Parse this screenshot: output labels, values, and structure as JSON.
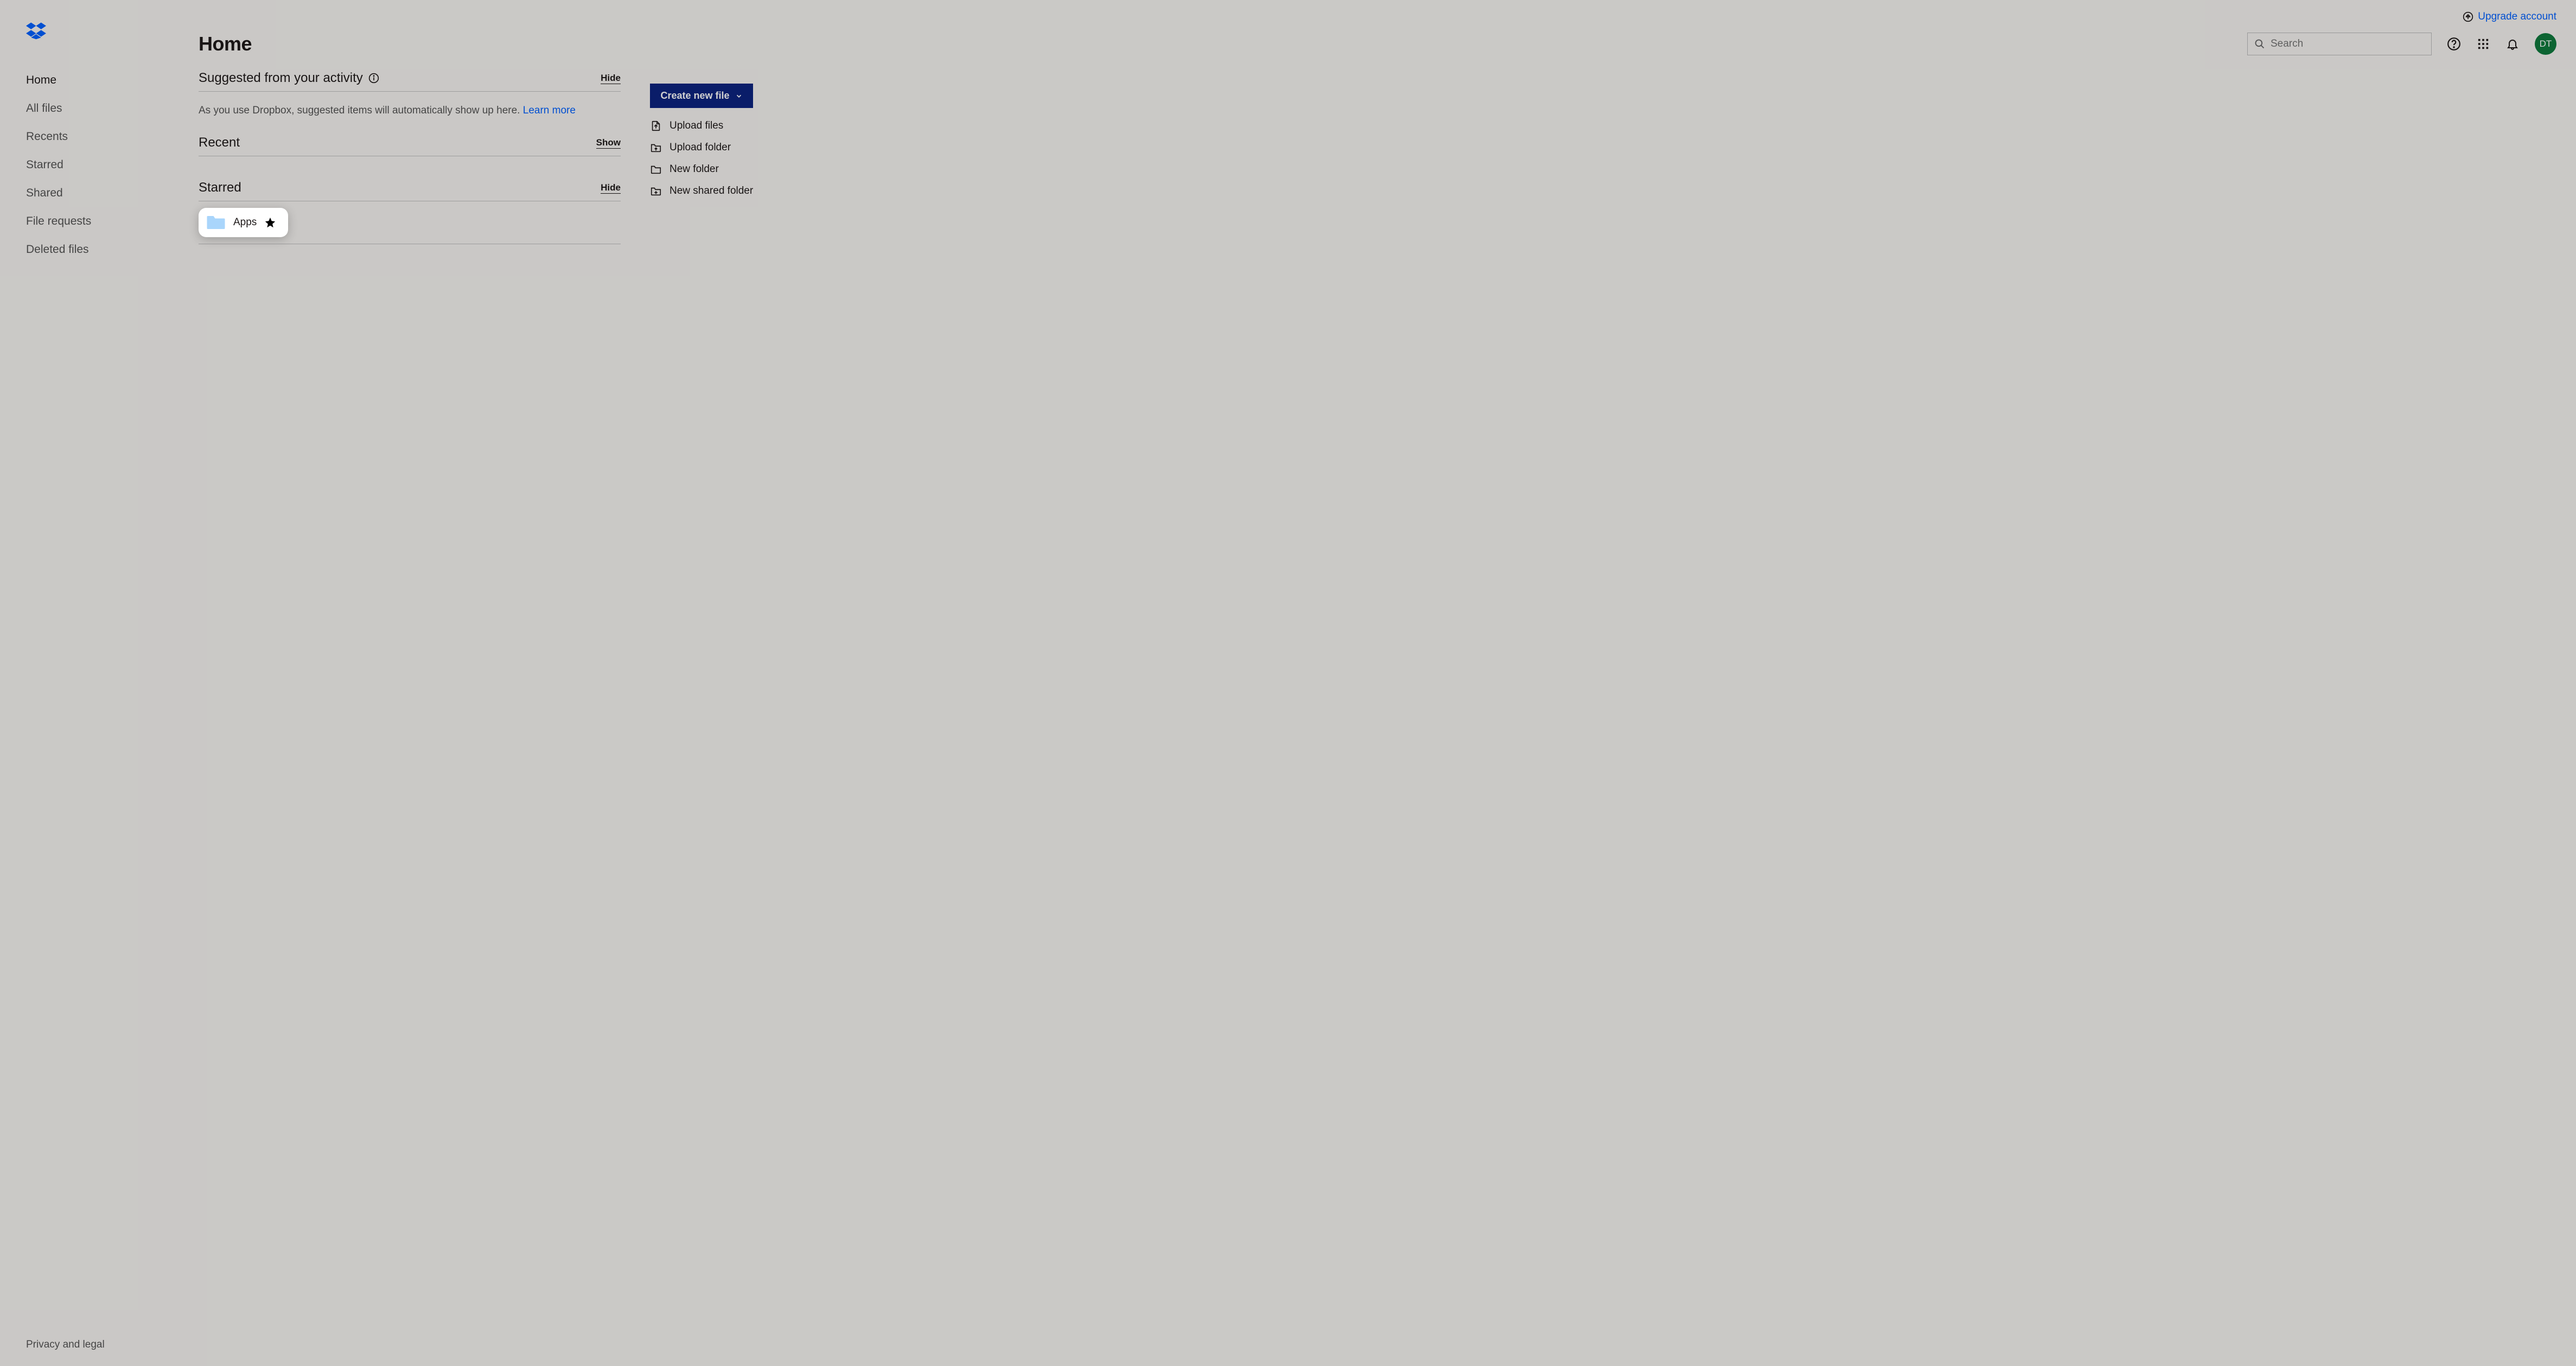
{
  "header": {
    "upgrade": "Upgrade account",
    "search_placeholder": "Search",
    "avatar_initials": "DT"
  },
  "sidebar": {
    "items": [
      {
        "label": "Home",
        "active": true
      },
      {
        "label": "All files"
      },
      {
        "label": "Recents"
      },
      {
        "label": "Starred"
      },
      {
        "label": "Shared"
      },
      {
        "label": "File requests"
      },
      {
        "label": "Deleted files"
      }
    ],
    "footer": "Privacy and legal"
  },
  "page": {
    "title": "Home"
  },
  "sections": {
    "suggested": {
      "title": "Suggested from your activity",
      "toggle": "Hide",
      "body_text": "As you use Dropbox, suggested items will automatically show up here. ",
      "learn_more": "Learn more"
    },
    "recent": {
      "title": "Recent",
      "toggle": "Show"
    },
    "starred": {
      "title": "Starred",
      "toggle": "Hide",
      "items": [
        {
          "name": "Apps"
        }
      ]
    }
  },
  "right": {
    "create_label": "Create new file",
    "actions": [
      {
        "label": "Upload files",
        "icon": "upload-file"
      },
      {
        "label": "Upload folder",
        "icon": "upload-folder"
      },
      {
        "label": "New folder",
        "icon": "folder"
      },
      {
        "label": "New shared folder",
        "icon": "shared-folder"
      }
    ]
  }
}
